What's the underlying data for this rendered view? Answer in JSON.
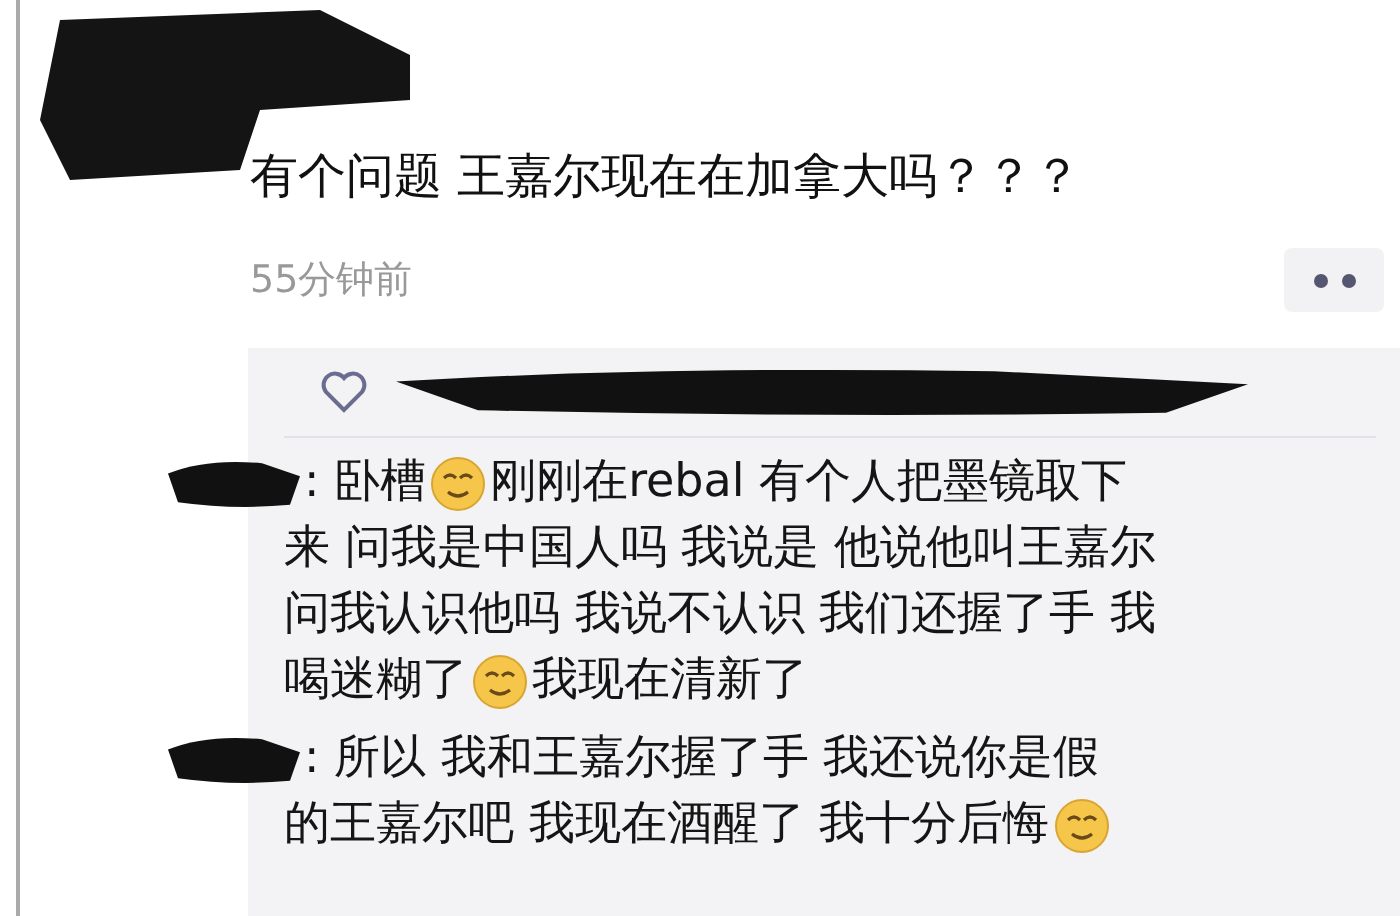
{
  "post": {
    "text": "有个问题 王嘉尔现在在加拿大吗？？？",
    "time": "55分钟前"
  },
  "comments": [
    {
      "separator": ":",
      "lines": [
        [
          {
            "kind": "text",
            "text": "卧槽"
          },
          {
            "kind": "emoji"
          },
          {
            "kind": "text",
            "text": "刚刚在rebal 有个人把墨镜取下"
          }
        ],
        [
          {
            "kind": "text",
            "text": "来 问我是中国人吗 我说是 他说他叫王嘉尔"
          }
        ],
        [
          {
            "kind": "text",
            "text": "问我认识他吗 我说不认识 我们还握了手 我"
          }
        ],
        [
          {
            "kind": "text",
            "text": "喝迷糊了"
          },
          {
            "kind": "emoji"
          },
          {
            "kind": "text",
            "text": "我现在清新了"
          }
        ]
      ]
    },
    {
      "separator": ":",
      "lines": [
        [
          {
            "kind": "text",
            "text": "所以 我和王嘉尔握了手 我还说你是假"
          }
        ],
        [
          {
            "kind": "text",
            "text": "的王嘉尔吧 我现在酒醒了 我十分后悔"
          },
          {
            "kind": "emoji"
          }
        ]
      ]
    }
  ]
}
